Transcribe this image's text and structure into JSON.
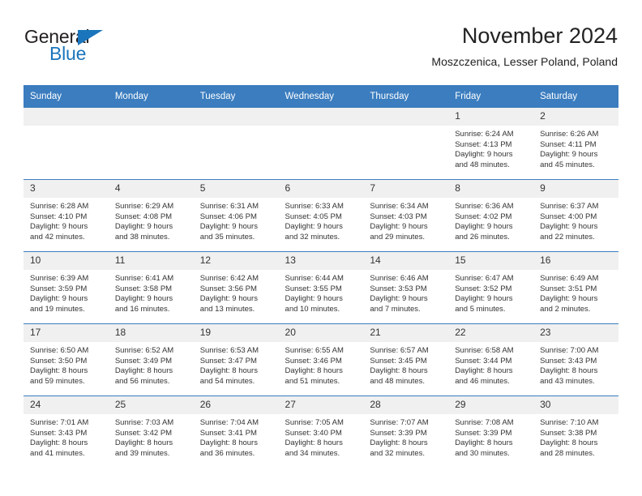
{
  "brand": {
    "name_dark": "General",
    "name_blue": "Blue",
    "accent_color": "#1b75bc"
  },
  "header": {
    "title": "November 2024",
    "subtitle": "Moszczenica, Lesser Poland, Poland"
  },
  "theme": {
    "header_bg": "#3b7dbf",
    "daynum_bg": "#f0f0f0",
    "text": "#333333"
  },
  "calendar": {
    "weekday_headers": [
      "Sunday",
      "Monday",
      "Tuesday",
      "Wednesday",
      "Thursday",
      "Friday",
      "Saturday"
    ],
    "weeks": [
      [
        {
          "day": "",
          "blank": true,
          "sunrise": "",
          "sunset": "",
          "daylight_line1": "",
          "daylight_line2": ""
        },
        {
          "day": "",
          "blank": true,
          "sunrise": "",
          "sunset": "",
          "daylight_line1": "",
          "daylight_line2": ""
        },
        {
          "day": "",
          "blank": true,
          "sunrise": "",
          "sunset": "",
          "daylight_line1": "",
          "daylight_line2": ""
        },
        {
          "day": "",
          "blank": true,
          "sunrise": "",
          "sunset": "",
          "daylight_line1": "",
          "daylight_line2": ""
        },
        {
          "day": "",
          "blank": true,
          "sunrise": "",
          "sunset": "",
          "daylight_line1": "",
          "daylight_line2": ""
        },
        {
          "day": "1",
          "blank": false,
          "sunrise": "Sunrise: 6:24 AM",
          "sunset": "Sunset: 4:13 PM",
          "daylight_line1": "Daylight: 9 hours",
          "daylight_line2": "and 48 minutes."
        },
        {
          "day": "2",
          "blank": false,
          "sunrise": "Sunrise: 6:26 AM",
          "sunset": "Sunset: 4:11 PM",
          "daylight_line1": "Daylight: 9 hours",
          "daylight_line2": "and 45 minutes."
        }
      ],
      [
        {
          "day": "3",
          "blank": false,
          "sunrise": "Sunrise: 6:28 AM",
          "sunset": "Sunset: 4:10 PM",
          "daylight_line1": "Daylight: 9 hours",
          "daylight_line2": "and 42 minutes."
        },
        {
          "day": "4",
          "blank": false,
          "sunrise": "Sunrise: 6:29 AM",
          "sunset": "Sunset: 4:08 PM",
          "daylight_line1": "Daylight: 9 hours",
          "daylight_line2": "and 38 minutes."
        },
        {
          "day": "5",
          "blank": false,
          "sunrise": "Sunrise: 6:31 AM",
          "sunset": "Sunset: 4:06 PM",
          "daylight_line1": "Daylight: 9 hours",
          "daylight_line2": "and 35 minutes."
        },
        {
          "day": "6",
          "blank": false,
          "sunrise": "Sunrise: 6:33 AM",
          "sunset": "Sunset: 4:05 PM",
          "daylight_line1": "Daylight: 9 hours",
          "daylight_line2": "and 32 minutes."
        },
        {
          "day": "7",
          "blank": false,
          "sunrise": "Sunrise: 6:34 AM",
          "sunset": "Sunset: 4:03 PM",
          "daylight_line1": "Daylight: 9 hours",
          "daylight_line2": "and 29 minutes."
        },
        {
          "day": "8",
          "blank": false,
          "sunrise": "Sunrise: 6:36 AM",
          "sunset": "Sunset: 4:02 PM",
          "daylight_line1": "Daylight: 9 hours",
          "daylight_line2": "and 26 minutes."
        },
        {
          "day": "9",
          "blank": false,
          "sunrise": "Sunrise: 6:37 AM",
          "sunset": "Sunset: 4:00 PM",
          "daylight_line1": "Daylight: 9 hours",
          "daylight_line2": "and 22 minutes."
        }
      ],
      [
        {
          "day": "10",
          "blank": false,
          "sunrise": "Sunrise: 6:39 AM",
          "sunset": "Sunset: 3:59 PM",
          "daylight_line1": "Daylight: 9 hours",
          "daylight_line2": "and 19 minutes."
        },
        {
          "day": "11",
          "blank": false,
          "sunrise": "Sunrise: 6:41 AM",
          "sunset": "Sunset: 3:58 PM",
          "daylight_line1": "Daylight: 9 hours",
          "daylight_line2": "and 16 minutes."
        },
        {
          "day": "12",
          "blank": false,
          "sunrise": "Sunrise: 6:42 AM",
          "sunset": "Sunset: 3:56 PM",
          "daylight_line1": "Daylight: 9 hours",
          "daylight_line2": "and 13 minutes."
        },
        {
          "day": "13",
          "blank": false,
          "sunrise": "Sunrise: 6:44 AM",
          "sunset": "Sunset: 3:55 PM",
          "daylight_line1": "Daylight: 9 hours",
          "daylight_line2": "and 10 minutes."
        },
        {
          "day": "14",
          "blank": false,
          "sunrise": "Sunrise: 6:46 AM",
          "sunset": "Sunset: 3:53 PM",
          "daylight_line1": "Daylight: 9 hours",
          "daylight_line2": "and 7 minutes."
        },
        {
          "day": "15",
          "blank": false,
          "sunrise": "Sunrise: 6:47 AM",
          "sunset": "Sunset: 3:52 PM",
          "daylight_line1": "Daylight: 9 hours",
          "daylight_line2": "and 5 minutes."
        },
        {
          "day": "16",
          "blank": false,
          "sunrise": "Sunrise: 6:49 AM",
          "sunset": "Sunset: 3:51 PM",
          "daylight_line1": "Daylight: 9 hours",
          "daylight_line2": "and 2 minutes."
        }
      ],
      [
        {
          "day": "17",
          "blank": false,
          "sunrise": "Sunrise: 6:50 AM",
          "sunset": "Sunset: 3:50 PM",
          "daylight_line1": "Daylight: 8 hours",
          "daylight_line2": "and 59 minutes."
        },
        {
          "day": "18",
          "blank": false,
          "sunrise": "Sunrise: 6:52 AM",
          "sunset": "Sunset: 3:49 PM",
          "daylight_line1": "Daylight: 8 hours",
          "daylight_line2": "and 56 minutes."
        },
        {
          "day": "19",
          "blank": false,
          "sunrise": "Sunrise: 6:53 AM",
          "sunset": "Sunset: 3:47 PM",
          "daylight_line1": "Daylight: 8 hours",
          "daylight_line2": "and 54 minutes."
        },
        {
          "day": "20",
          "blank": false,
          "sunrise": "Sunrise: 6:55 AM",
          "sunset": "Sunset: 3:46 PM",
          "daylight_line1": "Daylight: 8 hours",
          "daylight_line2": "and 51 minutes."
        },
        {
          "day": "21",
          "blank": false,
          "sunrise": "Sunrise: 6:57 AM",
          "sunset": "Sunset: 3:45 PM",
          "daylight_line1": "Daylight: 8 hours",
          "daylight_line2": "and 48 minutes."
        },
        {
          "day": "22",
          "blank": false,
          "sunrise": "Sunrise: 6:58 AM",
          "sunset": "Sunset: 3:44 PM",
          "daylight_line1": "Daylight: 8 hours",
          "daylight_line2": "and 46 minutes."
        },
        {
          "day": "23",
          "blank": false,
          "sunrise": "Sunrise: 7:00 AM",
          "sunset": "Sunset: 3:43 PM",
          "daylight_line1": "Daylight: 8 hours",
          "daylight_line2": "and 43 minutes."
        }
      ],
      [
        {
          "day": "24",
          "blank": false,
          "sunrise": "Sunrise: 7:01 AM",
          "sunset": "Sunset: 3:43 PM",
          "daylight_line1": "Daylight: 8 hours",
          "daylight_line2": "and 41 minutes."
        },
        {
          "day": "25",
          "blank": false,
          "sunrise": "Sunrise: 7:03 AM",
          "sunset": "Sunset: 3:42 PM",
          "daylight_line1": "Daylight: 8 hours",
          "daylight_line2": "and 39 minutes."
        },
        {
          "day": "26",
          "blank": false,
          "sunrise": "Sunrise: 7:04 AM",
          "sunset": "Sunset: 3:41 PM",
          "daylight_line1": "Daylight: 8 hours",
          "daylight_line2": "and 36 minutes."
        },
        {
          "day": "27",
          "blank": false,
          "sunrise": "Sunrise: 7:05 AM",
          "sunset": "Sunset: 3:40 PM",
          "daylight_line1": "Daylight: 8 hours",
          "daylight_line2": "and 34 minutes."
        },
        {
          "day": "28",
          "blank": false,
          "sunrise": "Sunrise: 7:07 AM",
          "sunset": "Sunset: 3:39 PM",
          "daylight_line1": "Daylight: 8 hours",
          "daylight_line2": "and 32 minutes."
        },
        {
          "day": "29",
          "blank": false,
          "sunrise": "Sunrise: 7:08 AM",
          "sunset": "Sunset: 3:39 PM",
          "daylight_line1": "Daylight: 8 hours",
          "daylight_line2": "and 30 minutes."
        },
        {
          "day": "30",
          "blank": false,
          "sunrise": "Sunrise: 7:10 AM",
          "sunset": "Sunset: 3:38 PM",
          "daylight_line1": "Daylight: 8 hours",
          "daylight_line2": "and 28 minutes."
        }
      ]
    ]
  }
}
